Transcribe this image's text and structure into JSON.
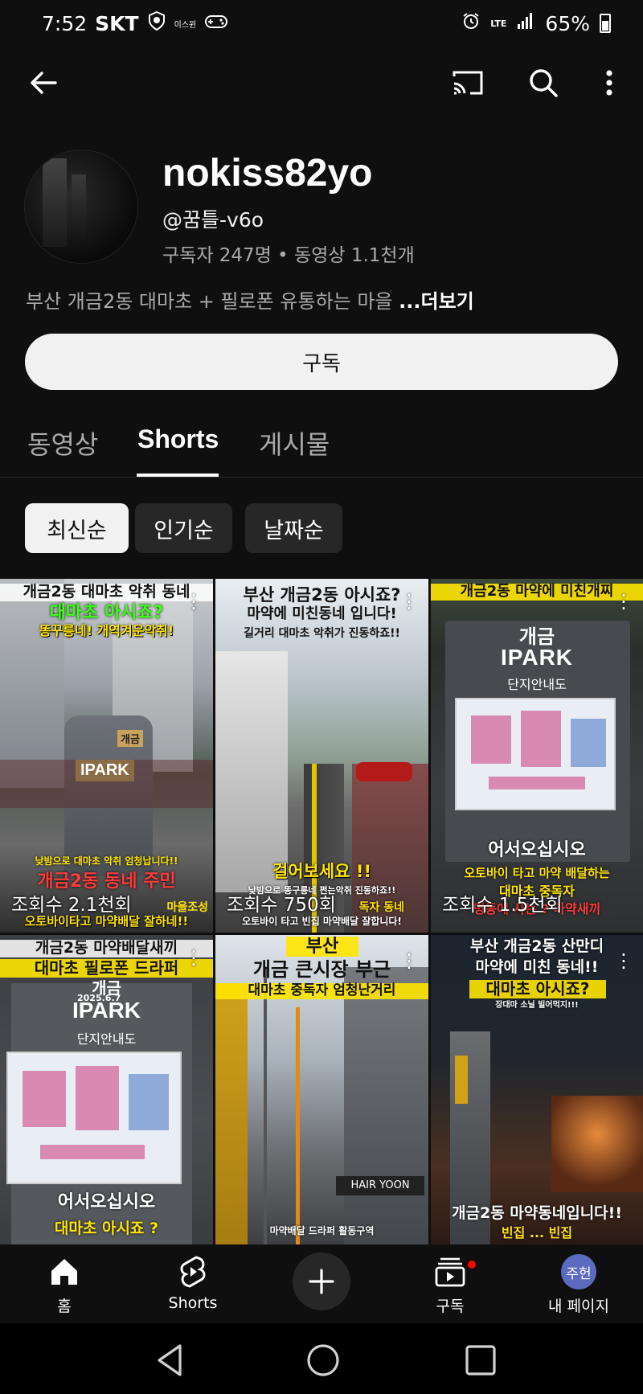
{
  "status_bar": {
    "time": "7:52",
    "carrier": "SKT",
    "extra_label": "이스윈",
    "network": "LTE",
    "battery": "65%",
    "icons": [
      "shield-icon",
      "gamepad-icon",
      "alarm-icon",
      "signal-icon",
      "battery-icon"
    ]
  },
  "top_bar": {
    "icons": [
      "back-arrow-icon",
      "cast-icon",
      "search-icon",
      "more-vert-icon"
    ]
  },
  "channel": {
    "name": "nokiss82yo",
    "handle": "@꿈틀-v6o",
    "stats": "구독자 247명 • 동영상 1.1천개",
    "description": "부산 개금2동 대마초 + 필로폰 유통하는 마을 ",
    "more_label": "...더보기",
    "subscribe_label": "구독"
  },
  "tabs": [
    {
      "label": "동영상",
      "active": false
    },
    {
      "label": "Shorts",
      "active": true
    },
    {
      "label": "게시물",
      "active": false
    }
  ],
  "chips": [
    {
      "label": "최신순",
      "active": true
    },
    {
      "label": "인기순",
      "active": false
    },
    {
      "label": "날짜순",
      "active": false
    }
  ],
  "shorts": [
    {
      "caption_top": "개금2동 대마초 악취 동네",
      "caption_2": "대마초 아시죠?",
      "caption_3": "똥꾸릉네! 개역겨운악취!",
      "sign": "IPARK",
      "sign_tag": "개금",
      "caption_bottom_1": "낮밤으로 대마초 악취 엄청납니다!!",
      "caption_bottom_2": "개금2동 동네 주민",
      "caption_bottom_3": "오토바이타고 마약배달 잘하네!!",
      "caption_bottom_4": "마을조성",
      "views": "조회수 2.1천회"
    },
    {
      "caption_top": "부산 개금2동 아시죠?",
      "caption_2": "마약에 미친동네 입니다!",
      "caption_3": "길거리 대마초 악취가 진동하죠!!",
      "caption_bottom_1": "걸어보세요 !!",
      "caption_bottom_2": "낮밤으로 똥구릉네 쩐는악취 진동하죠!!",
      "caption_bottom_3": "오토바이 타고 빈집 마약배달 잘합니다!",
      "caption_bottom_4": "독자 동네",
      "views": "조회수 750회"
    },
    {
      "caption_top": "개금2동 마약에 미친개찌",
      "sign_1": "개금",
      "sign_2": "IPARK",
      "sign_3": "단지안내도",
      "caption_bottom_1": "어서오십시오",
      "caption_bottom_2": "오토바이 타고 마약 배달하는",
      "caption_bottom_3": "명동에 사는 ? 마약새끼",
      "caption_bottom_4": "대마초 중독자",
      "views": "조회수 1.5천회"
    },
    {
      "caption_top": "개금2동 마약배달새끼",
      "caption_2": "대마초 필로폰 드라퍼",
      "sign_1": "개금",
      "sign_2": "IPARK",
      "sign_date": "2025.6.7",
      "sign_3": "단지안내도",
      "caption_bottom_1": "어서오십시오",
      "caption_bottom_2": "대마초 아시죠 ?"
    },
    {
      "caption_top": "부산",
      "caption_2": "개금 큰시장 부근",
      "caption_3": "대마초 중독자 엄청난거리",
      "store_sign": "HAIR YOON",
      "caption_bottom_1": "마약배달 드라퍼 활동구역"
    },
    {
      "caption_top": "부산 개금2동 산만디",
      "caption_2": "마약에 미친 동네!!",
      "caption_3": "대마초 아시죠?",
      "caption_4": "장대마 소닐 빌어먹지!!!",
      "caption_bottom_1": "개금2동 마약동네입니다!!",
      "caption_bottom_2": "빈집 ... 빈집"
    }
  ],
  "bottom_nav": [
    {
      "label": "홈",
      "icon": "home-icon"
    },
    {
      "label": "Shorts",
      "icon": "shorts-icon"
    },
    {
      "label": "",
      "icon": "create-plus-icon"
    },
    {
      "label": "구독",
      "icon": "subscriptions-icon"
    },
    {
      "label": "내 페이지",
      "icon": "avatar",
      "avatar_text": "주헌"
    }
  ],
  "system_nav": [
    "back-triangle-icon",
    "home-circle-icon",
    "recents-square-icon"
  ]
}
